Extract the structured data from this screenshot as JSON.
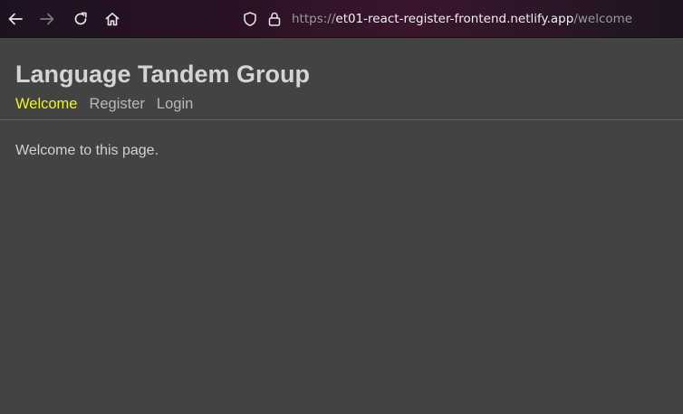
{
  "browser": {
    "url_scheme": "https://",
    "url_host": "et01-react-register-frontend.netlify.app",
    "url_path": "/welcome",
    "icons": [
      "back-arrow-icon",
      "forward-arrow-icon",
      "reload-icon",
      "home-icon",
      "shield-icon",
      "lock-icon"
    ]
  },
  "site": {
    "title": "Language Tandem Group",
    "nav": [
      {
        "label": "Welcome",
        "active": true
      },
      {
        "label": "Register",
        "active": false
      },
      {
        "label": "Login",
        "active": false
      }
    ]
  },
  "main": {
    "text": "Welcome to this page."
  },
  "colors": {
    "page_background": "#434343",
    "active_nav": "#f2f21c",
    "nav": "#b8b8b8",
    "title": "#d4d4d4"
  }
}
